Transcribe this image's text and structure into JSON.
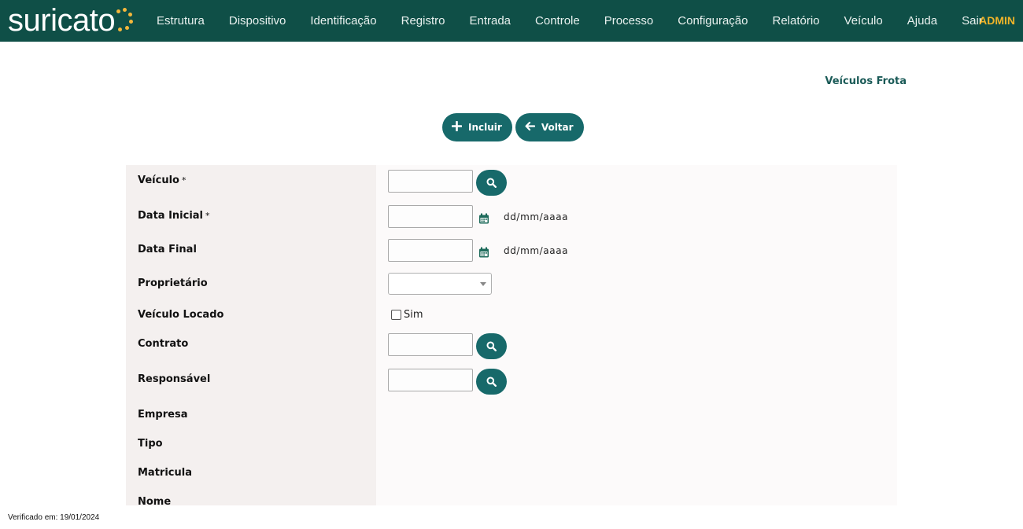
{
  "app": {
    "logo_text": "suricato",
    "user": "ADMIN"
  },
  "nav": {
    "items": [
      "Estrutura",
      "Dispositivo",
      "Identificação",
      "Registro",
      "Entrada",
      "Controle",
      "Processo",
      "Configuração",
      "Relatório",
      "Veículo",
      "Ajuda",
      "Sair"
    ]
  },
  "page": {
    "title": "Veículos Frota"
  },
  "actions": {
    "include_label": "Incluir",
    "back_label": "Voltar"
  },
  "form": {
    "vehicle": {
      "label": "Veículo",
      "required": "*",
      "value": ""
    },
    "start_date": {
      "label": "Data Inicial",
      "required": "*",
      "value": "",
      "hint": "dd/mm/aaaa"
    },
    "end_date": {
      "label": "Data Final",
      "value": "",
      "hint": "dd/mm/aaaa"
    },
    "owner": {
      "label": "Proprietário",
      "selected": ""
    },
    "leased": {
      "label": "Veículo Locado",
      "option": "Sim",
      "checked": false
    },
    "contract": {
      "label": "Contrato",
      "value": ""
    },
    "responsible": {
      "label": "Responsável",
      "value": ""
    },
    "company": {
      "label": "Empresa"
    },
    "type": {
      "label": "Tipo"
    },
    "registration": {
      "label": "Matricula"
    },
    "name": {
      "label": "Nome"
    }
  },
  "footer": {
    "verified": "Verificado em: 19/01/2024"
  },
  "colors": {
    "header_bg": "#0f4f47",
    "accent": "#17696a",
    "admin": "#f0b429",
    "logo_dots": "#f4b73b"
  },
  "icons": {
    "include": "plus-icon",
    "back": "arrow-left-icon",
    "search": "search-icon",
    "calendar": "calendar-icon"
  }
}
